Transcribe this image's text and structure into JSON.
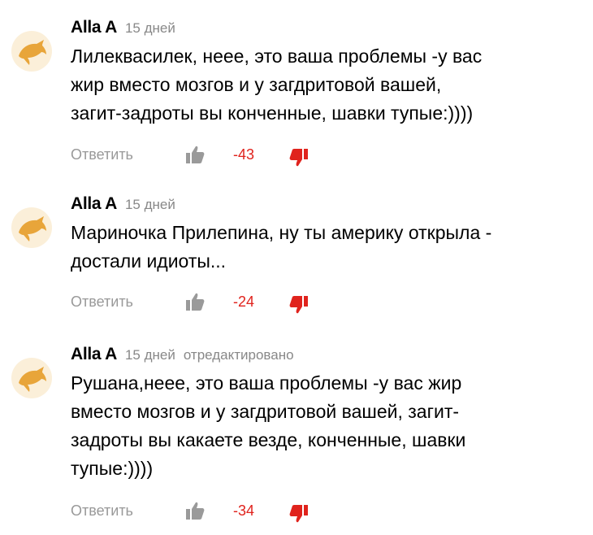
{
  "comments": [
    {
      "author": "Alla A",
      "time": "15 дней",
      "edited": "",
      "lines": [
        "Лилеквасилек, неее, это ваша проблемы -у вас",
        "жир вместо мозгов и у загдритовой вашей,",
        "загит-задроты вы конченные, шавки тупые:))))"
      ],
      "reply_label": "Ответить",
      "score": "-43"
    },
    {
      "author": "Alla A",
      "time": "15 дней",
      "edited": "",
      "lines": [
        "Мариночка Прилепина, ну ты америку открыла -",
        "достали идиоты..."
      ],
      "reply_label": "Ответить",
      "score": "-24"
    },
    {
      "author": "Alla A",
      "time": "15 дней",
      "edited": "отредактировано",
      "lines": [
        "Рушана,неее, это ваша проблемы -у вас жир",
        "вместо мозгов и у загдритовой вашей, загит-",
        "задроты вы какаете везде, конченные, шавки",
        "тупые:))))"
      ],
      "reply_label": "Ответить",
      "score": "-34"
    }
  ],
  "icons": {
    "avatar": "dolphin-avatar-icon",
    "like": "thumbs-up-icon",
    "dislike": "thumbs-down-icon"
  },
  "colors": {
    "avatar_bg": "#fbefd9",
    "avatar_dolphin": "#e8a53a",
    "score": "#e0231d",
    "dislike": "#e0231d",
    "muted": "#999999"
  }
}
